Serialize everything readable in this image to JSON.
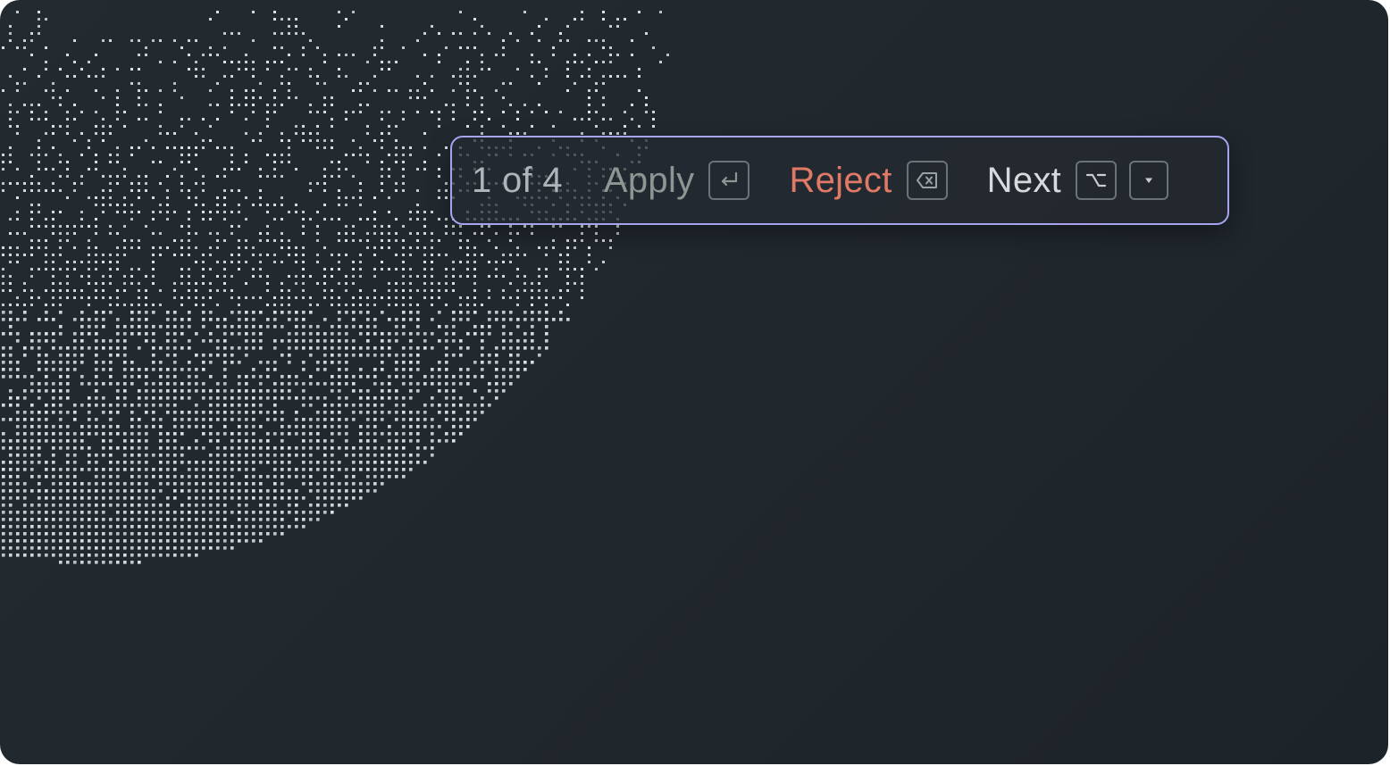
{
  "suggestion_bar": {
    "counter": "1 of 4",
    "apply_label": "Apply",
    "reject_label": "Reject",
    "next_label": "Next"
  },
  "icons": {
    "apply_key": "enter-icon",
    "reject_key": "backspace-icon",
    "next_key": "option-icon",
    "next_extra_key": "chevron-down-icon"
  },
  "colors": {
    "background": "#20272d",
    "toolbar_border": "#a8a3ef",
    "reject": "#e07a66",
    "apply": "#8d9693",
    "next": "#d6dadc",
    "counter": "#aeb4b8"
  }
}
